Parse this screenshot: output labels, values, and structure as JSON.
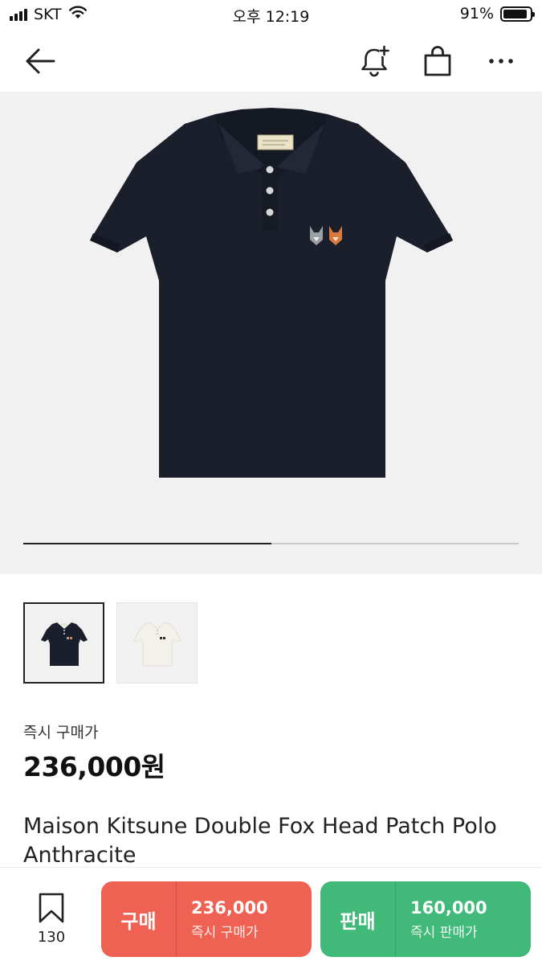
{
  "status_bar": {
    "carrier": "SKT",
    "time": "오후 12:19",
    "battery_text": "91%",
    "battery_level": 0.91
  },
  "nav": {
    "icons": [
      "back-arrow-icon",
      "bell-plus-icon",
      "shopping-bag-icon",
      "more-icon"
    ]
  },
  "gallery": {
    "progress": 0.5,
    "thumbnails": [
      {
        "color": "anthracite",
        "selected": true
      },
      {
        "color": "white",
        "selected": false
      }
    ]
  },
  "product": {
    "price_label": "즉시 구매가",
    "price": "236,000원",
    "title": "Maison Kitsune Double Fox Head Patch Polo Anthracite"
  },
  "bottom_bar": {
    "wish_count": "130",
    "buy": {
      "action": "구매",
      "price": "236,000",
      "sub": "즉시 구매가",
      "color": "#ef6253"
    },
    "sell": {
      "action": "판매",
      "price": "160,000",
      "sub": "즉시 판매가",
      "color": "#41b979"
    }
  }
}
